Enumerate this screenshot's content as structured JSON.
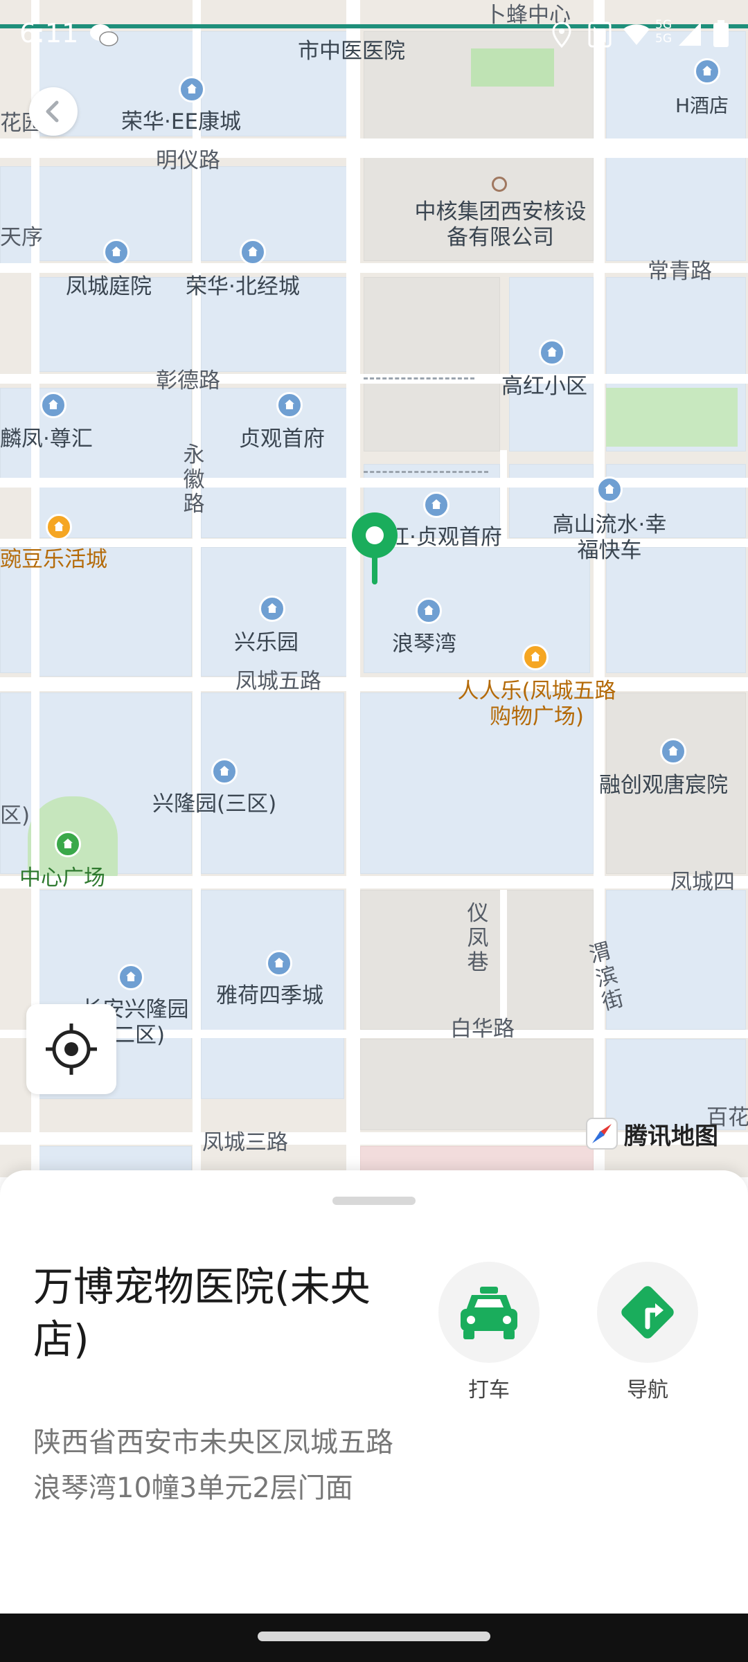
{
  "status_bar": {
    "time": "6:11",
    "network_label": "5G 5G",
    "icons": [
      "wechat-icon",
      "location-icon",
      "nfc-icon",
      "wifi-icon",
      "signal-icon",
      "battery-icon"
    ]
  },
  "map": {
    "provider_label": "腾讯地图",
    "roads": [
      "明仪路",
      "常青路",
      "彰德路",
      "永徽路",
      "凤城五路",
      "仪凤巷",
      "渭滨街",
      "白华路",
      "凤城三路",
      "凤城四"
    ],
    "places": [
      "卜蜂中心",
      "市中医医院",
      "花园",
      "荣华·EE康城",
      "H酒店",
      "中核集团西安核设备有限公司",
      "天序",
      "凤城庭院",
      "荣华·北经城",
      "高红小区",
      "麟凤·尊汇",
      "贞观首府",
      "红·贞观首府",
      "高山流水·幸福快车",
      "豌豆乐活城",
      "兴乐园",
      "浪琴湾",
      "人人乐(凤城五路购物广场)",
      "兴隆园(三区)",
      "融创观唐宸院",
      "中心广场",
      "雅荷四季城",
      "长安兴隆园(二区)",
      "百花",
      "区)"
    ]
  },
  "sheet": {
    "place_name": "万博宠物医院(未央店)",
    "address": "陕西省西安市未央区凤城五路浪琴湾10幢3单元2层门面",
    "actions": [
      {
        "label": "打车",
        "icon": "taxi-icon"
      },
      {
        "label": "导航",
        "icon": "navigation-icon"
      }
    ]
  },
  "colors": {
    "accent": "#1aad5c",
    "map_bg": "#eeeae4",
    "block": "#dfe9f4",
    "poi_blue": "#6f9fd2",
    "poi_orange": "#f5a623"
  }
}
